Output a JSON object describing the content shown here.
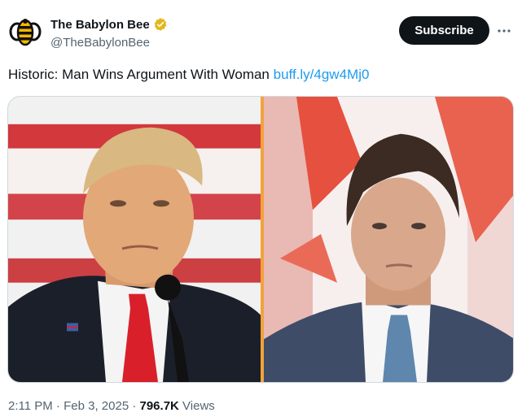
{
  "tweet": {
    "author": {
      "display_name": "The Babylon Bee",
      "handle": "@TheBabylonBee",
      "avatar_icon": "bee-logo-icon",
      "verified_icon": "verified-badge-icon",
      "verified_color": "#e2b719"
    },
    "subscribe_label": "Subscribe",
    "more_icon": "more-options-icon",
    "text": "Historic: Man Wins Argument With Woman",
    "link_text": "buff.ly/4gw4Mj0",
    "link_color": "#1d9bf0",
    "media": {
      "left_photo": "photo-trump",
      "right_photo": "photo-trudeau"
    },
    "time": "2:11 PM",
    "date": "Feb 3, 2025",
    "views_count": "796.7K",
    "views_label": "Views"
  }
}
